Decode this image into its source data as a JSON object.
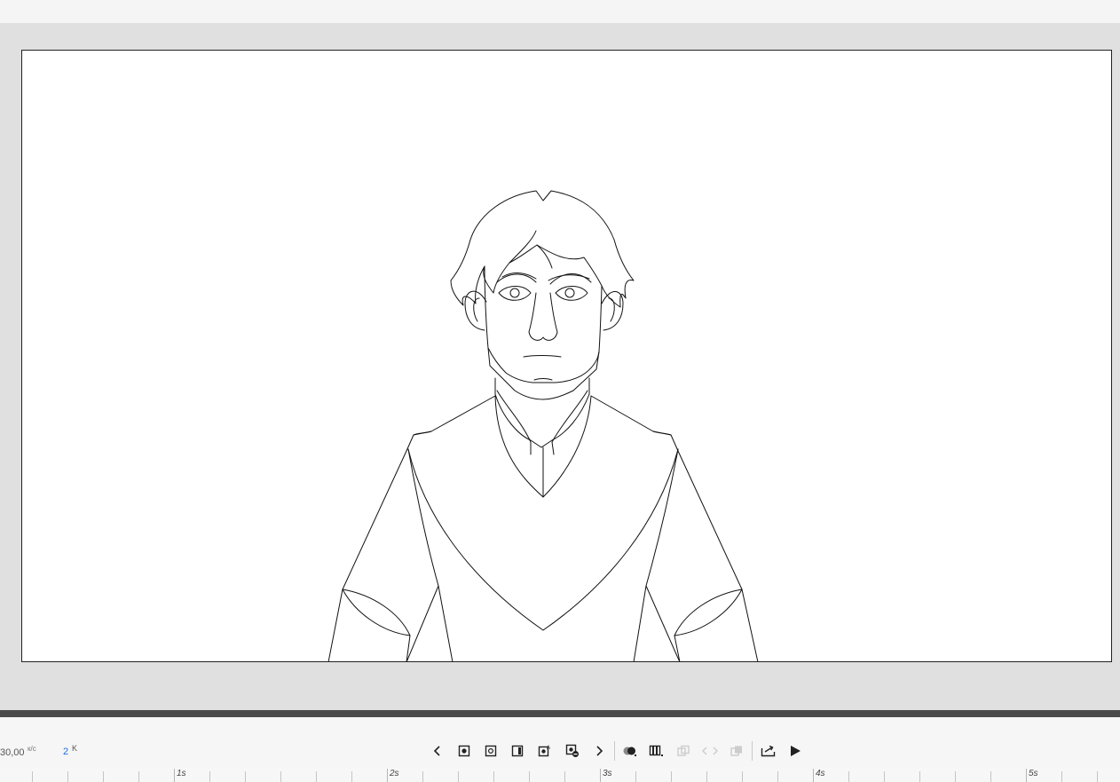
{
  "timeline": {
    "fps": "30,00",
    "fps_unit": "к/с",
    "keyframe_count": "2",
    "keyframe_unit": "K"
  },
  "toolbar": {
    "buttons": [
      {
        "name": "prev-frame-button",
        "icon": "chevron-left-icon",
        "enabled": true
      },
      {
        "name": "insert-keyframe-button",
        "icon": "keyframe-filled-icon",
        "enabled": true
      },
      {
        "name": "insert-blank-keyframe-button",
        "icon": "keyframe-blank-icon",
        "enabled": true
      },
      {
        "name": "insert-frame-button",
        "icon": "frame-icon",
        "enabled": true
      },
      {
        "name": "auto-keyframe-button",
        "icon": "auto-keyframe-icon",
        "enabled": true
      },
      {
        "name": "clear-keyframe-button",
        "icon": "clear-keyframe-icon",
        "enabled": true
      },
      {
        "name": "next-frame-button",
        "icon": "chevron-right-icon",
        "enabled": true
      },
      {
        "name": "onion-skin-button",
        "icon": "onion-skin-icon",
        "enabled": true
      },
      {
        "name": "edit-multiple-frames-button",
        "icon": "multiple-frames-icon",
        "enabled": true
      },
      {
        "name": "convert-to-symbol-button",
        "icon": "symbol-icon",
        "enabled": false
      },
      {
        "name": "sync-button",
        "icon": "arrows-icon",
        "enabled": false
      },
      {
        "name": "swap-button",
        "icon": "swap-icon",
        "enabled": false
      },
      {
        "name": "export-button",
        "icon": "export-icon",
        "enabled": true
      },
      {
        "name": "play-button",
        "icon": "play-icon",
        "enabled": true
      }
    ]
  },
  "ruler": {
    "labels": [
      "1s",
      "2s",
      "3s",
      "4s",
      "5s"
    ]
  },
  "colors": {
    "stage_bg": "#e0e0e0",
    "canvas_bg": "#ffffff",
    "accent": "#1473e6",
    "divider": "#4a4a4a"
  }
}
